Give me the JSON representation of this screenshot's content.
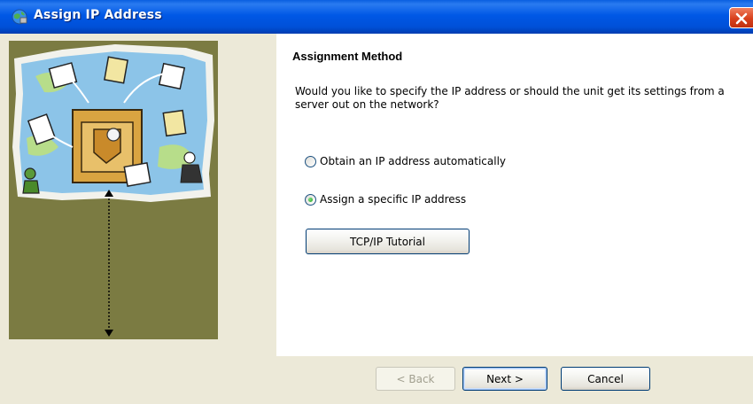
{
  "window": {
    "title": "Assign IP Address",
    "icon": "network-globe-icon"
  },
  "page": {
    "section_title": "Assignment Method",
    "description": "Would you like to specify the IP address or should the unit get its settings from a server out on the network?"
  },
  "options": [
    {
      "label": "Obtain an IP address automatically",
      "selected": false
    },
    {
      "label": "Assign a specific IP address",
      "selected": true
    }
  ],
  "buttons": {
    "tutorial": "TCP/IP Tutorial",
    "back": "< Back",
    "next": "Next >",
    "cancel": "Cancel"
  },
  "colors": {
    "titlebar": "#0058e6",
    "window_bg": "#ece9d8",
    "side_panel": "#7b7b42",
    "close_button": "#d8401c"
  }
}
